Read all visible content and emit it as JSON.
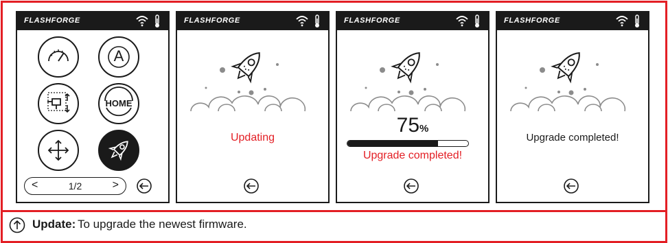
{
  "brand": "FLASHFORGE",
  "colors": {
    "accent_red": "#e31e24",
    "screen_dark": "#1a1a1a"
  },
  "status_icons": [
    "wifi-icon",
    "thermometer-icon"
  ],
  "screens": [
    {
      "id": "menu",
      "buttons": [
        {
          "name": "speed-gauge-button",
          "icon": "speedometer-icon"
        },
        {
          "name": "auto-button",
          "label": "A"
        },
        {
          "name": "extrude-button",
          "icon": "extruder-icon"
        },
        {
          "name": "home-button",
          "label": "HOME"
        },
        {
          "name": "move-button",
          "icon": "move-arrows-icon"
        },
        {
          "name": "update-button",
          "icon": "rocket-icon",
          "selected": true
        }
      ],
      "pager": {
        "prev": "<",
        "page": "1/2",
        "next": ">"
      },
      "back_icon": "back-arrow-icon"
    },
    {
      "id": "updating",
      "message": "Updating",
      "back_icon": "back-arrow-icon"
    },
    {
      "id": "progress",
      "percent_value": "75",
      "percent_sign": "%",
      "progress_fraction": 0.75,
      "message": "Upgrade completed!",
      "back_icon": "back-arrow-icon"
    },
    {
      "id": "completed",
      "message": "Upgrade completed!",
      "back_icon": "back-arrow-icon"
    }
  ],
  "caption": {
    "icon": "upload-arrow-icon",
    "label": "Update:",
    "description": "To upgrade the newest firmware."
  }
}
